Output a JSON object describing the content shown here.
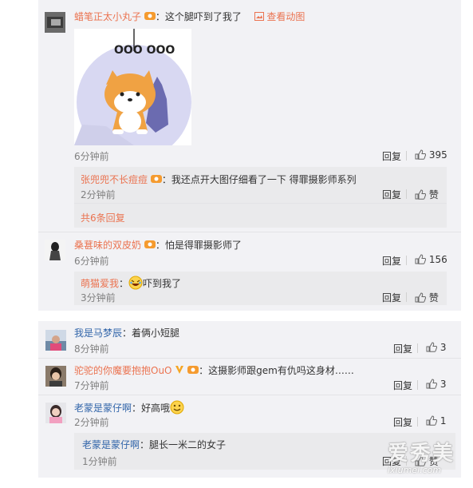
{
  "actions": {
    "reply": "回复",
    "like": "赞"
  },
  "thread1": {
    "comment": {
      "username": "蜡笔正太小丸子",
      "separator": "：",
      "text": "这个腿吓到了我了",
      "view_gif": "查看动图",
      "time": "6分钟前",
      "likes": "395",
      "image_caption": "OOO OOO"
    },
    "replies": [
      {
        "username": "张兜兜不长痘痘",
        "text": "我还点开大图仔细看了一下 得罪摄影师系列",
        "time": "2分钟前"
      }
    ],
    "more": "共6条回复"
  },
  "thread2": {
    "comment": {
      "username": "桑葚味的双皮奶",
      "separator": "：",
      "text": "怕是得罪摄影师了",
      "time": "6分钟前",
      "likes": "156"
    },
    "replies": [
      {
        "username": "萌猫爱我",
        "separator": "：",
        "text": "吓到我了",
        "time": "3分钟前"
      }
    ]
  },
  "thread3": {
    "comments": [
      {
        "username": "我是马梦辰",
        "separator": "：",
        "text": "着俩小短腿",
        "time": "8分钟前",
        "likes": "3"
      },
      {
        "username": "驼驼的你魔要抱抱OuO",
        "separator": "：",
        "text": "这摄影师跟gem有仇吗这身材……",
        "time": "7分钟前",
        "likes": "3"
      },
      {
        "username": "老蒙是蒙仔啊",
        "separator": "：",
        "text": "好高哦",
        "time": "2分钟前",
        "likes": "1"
      }
    ],
    "reply": {
      "username": "老蒙是蒙仔啊",
      "separator": "：",
      "text": "腿长一米二的女子",
      "time": "1分钟前"
    }
  },
  "watermark": {
    "main": "爱秀美",
    "sub": "ixiumei.com"
  },
  "colors": {
    "username_orange": "#eb7350",
    "username_blue": "#3366aa",
    "panel_bg": "#f2f2f5"
  },
  "icons": [
    "thumb-up-icon",
    "vip-badge-icon",
    "gif-icon",
    "laughing-emoji-icon",
    "smile-emoji-icon",
    "verified-v-icon"
  ]
}
